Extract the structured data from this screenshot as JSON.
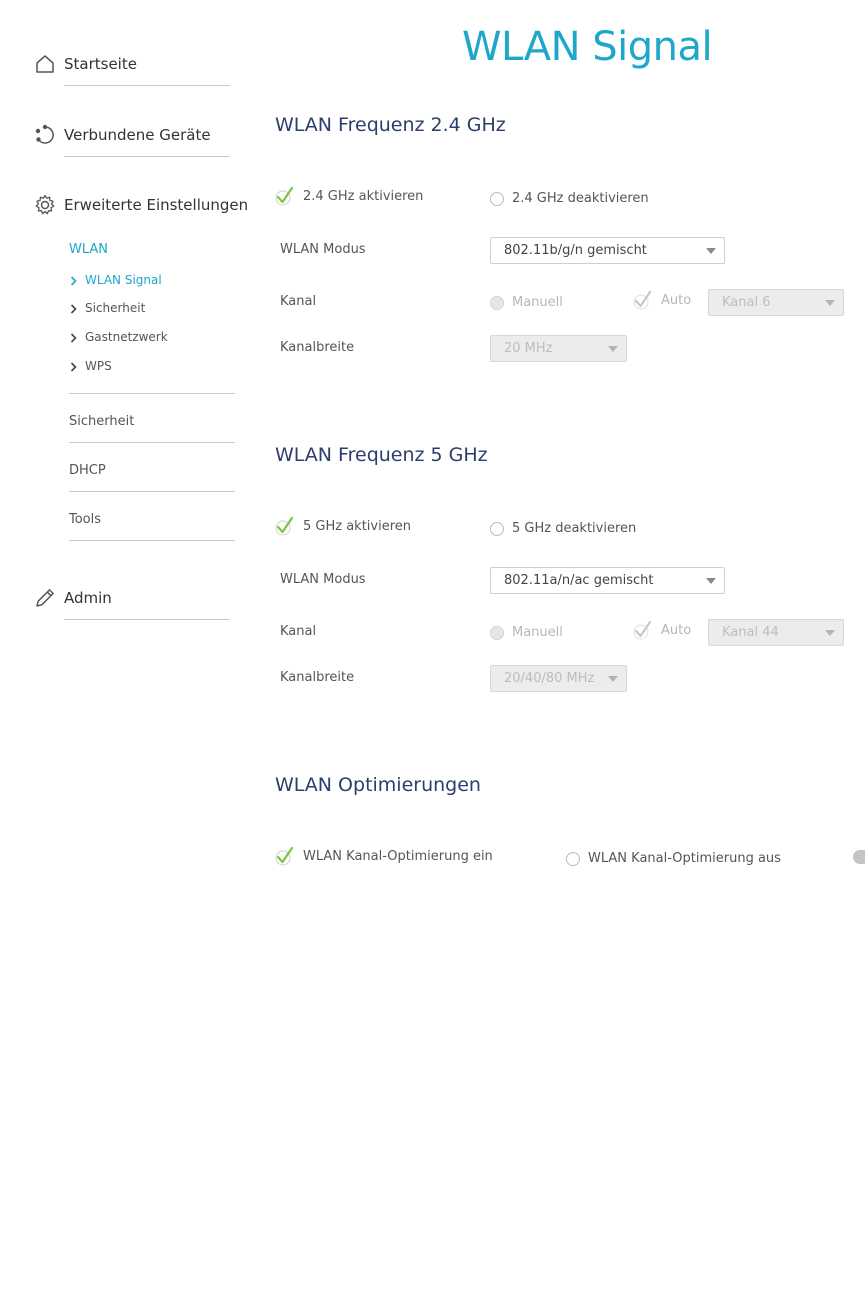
{
  "sidebar": {
    "home": "Startseite",
    "devices": "Verbundene Geräte",
    "advanced": "Erweiterte Einstellungen",
    "wlan": "WLAN",
    "wlan_items": [
      "WLAN Signal",
      "Sicherheit",
      "Gastnetzwerk",
      "WPS"
    ],
    "sections": [
      "Sicherheit",
      "DHCP",
      "Tools"
    ],
    "admin": "Admin"
  },
  "page": {
    "title": "WLAN Signal"
  },
  "band24": {
    "title": "WLAN Frequenz 2.4 GHz",
    "enable": "2.4 GHz aktivieren",
    "disable": "2.4 GHz deaktivieren",
    "mode_label": "WLAN Modus",
    "mode_value": "802.11b/g/n gemischt",
    "channel_label": "Kanal",
    "manual": "Manuell",
    "auto": "Auto",
    "channel_value": "Kanal 6",
    "width_label": "Kanalbreite",
    "width_value": "20 MHz"
  },
  "band5": {
    "title": "WLAN Frequenz 5 GHz",
    "enable": "5 GHz aktivieren",
    "disable": "5 GHz deaktivieren",
    "mode_label": "WLAN Modus",
    "mode_value": "802.11a/n/ac gemischt",
    "channel_label": "Kanal",
    "manual": "Manuell",
    "auto": "Auto",
    "channel_value": "Kanal 44",
    "width_label": "Kanalbreite",
    "width_value": "20/40/80 MHz"
  },
  "optimize": {
    "title": "WLAN Optimierungen",
    "on": "WLAN Kanal-Optimierung ein",
    "off": "WLAN Kanal-Optimierung aus"
  },
  "colors": {
    "accent": "#1ea7c9",
    "heading": "#2c3e6b",
    "check": "#7ec242",
    "check_disabled": "#c8c8c8"
  }
}
